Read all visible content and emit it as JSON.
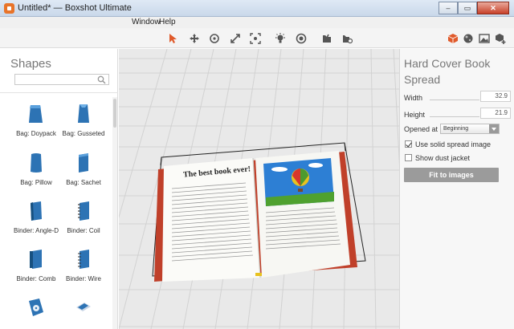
{
  "window": {
    "title": "Untitled* — Boxshot Ultimate",
    "minimize_glyph": "–",
    "maximize_glyph": "▭",
    "close_glyph": "✕"
  },
  "menu": {
    "items": [
      "Window",
      "Help"
    ]
  },
  "toolbar": {
    "tools": [
      "select-arrow-icon",
      "move-icon",
      "rotate-icon",
      "scale-icon",
      "frame-icon",
      "light-icon",
      "camera-icon",
      "render-icon",
      "render-settings-icon",
      "box-icon",
      "sphere-icon",
      "image-icon",
      "add-object-icon"
    ],
    "accent_color": "#e05a2b"
  },
  "sidebar": {
    "title": "Shapes",
    "search": {
      "value": "",
      "placeholder": ""
    },
    "items": [
      {
        "label": "Bag: Doypack"
      },
      {
        "label": "Bag: Gusseted"
      },
      {
        "label": "Bag: Pillow"
      },
      {
        "label": "Bag: Sachet"
      },
      {
        "label": "Binder: Angle-D"
      },
      {
        "label": "Binder: Coil"
      },
      {
        "label": "Binder: Comb"
      },
      {
        "label": "Binder: Wire"
      },
      {
        "label": ""
      },
      {
        "label": ""
      }
    ]
  },
  "viewport": {
    "book": {
      "headline": "The best book ever!",
      "cover_color": "#c0402a"
    }
  },
  "properties": {
    "title": "Hard Cover Book Spread",
    "width_label": "Width",
    "width_value": "32.9",
    "height_label": "Height",
    "height_value": "21.9",
    "opened_at_label": "Opened at",
    "opened_at_value": "Beginning",
    "use_solid_spread_label": "Use solid spread image",
    "use_solid_spread_checked": true,
    "show_dust_jacket_label": "Show dust jacket",
    "show_dust_jacket_checked": false,
    "fit_button_label": "Fit to images"
  }
}
